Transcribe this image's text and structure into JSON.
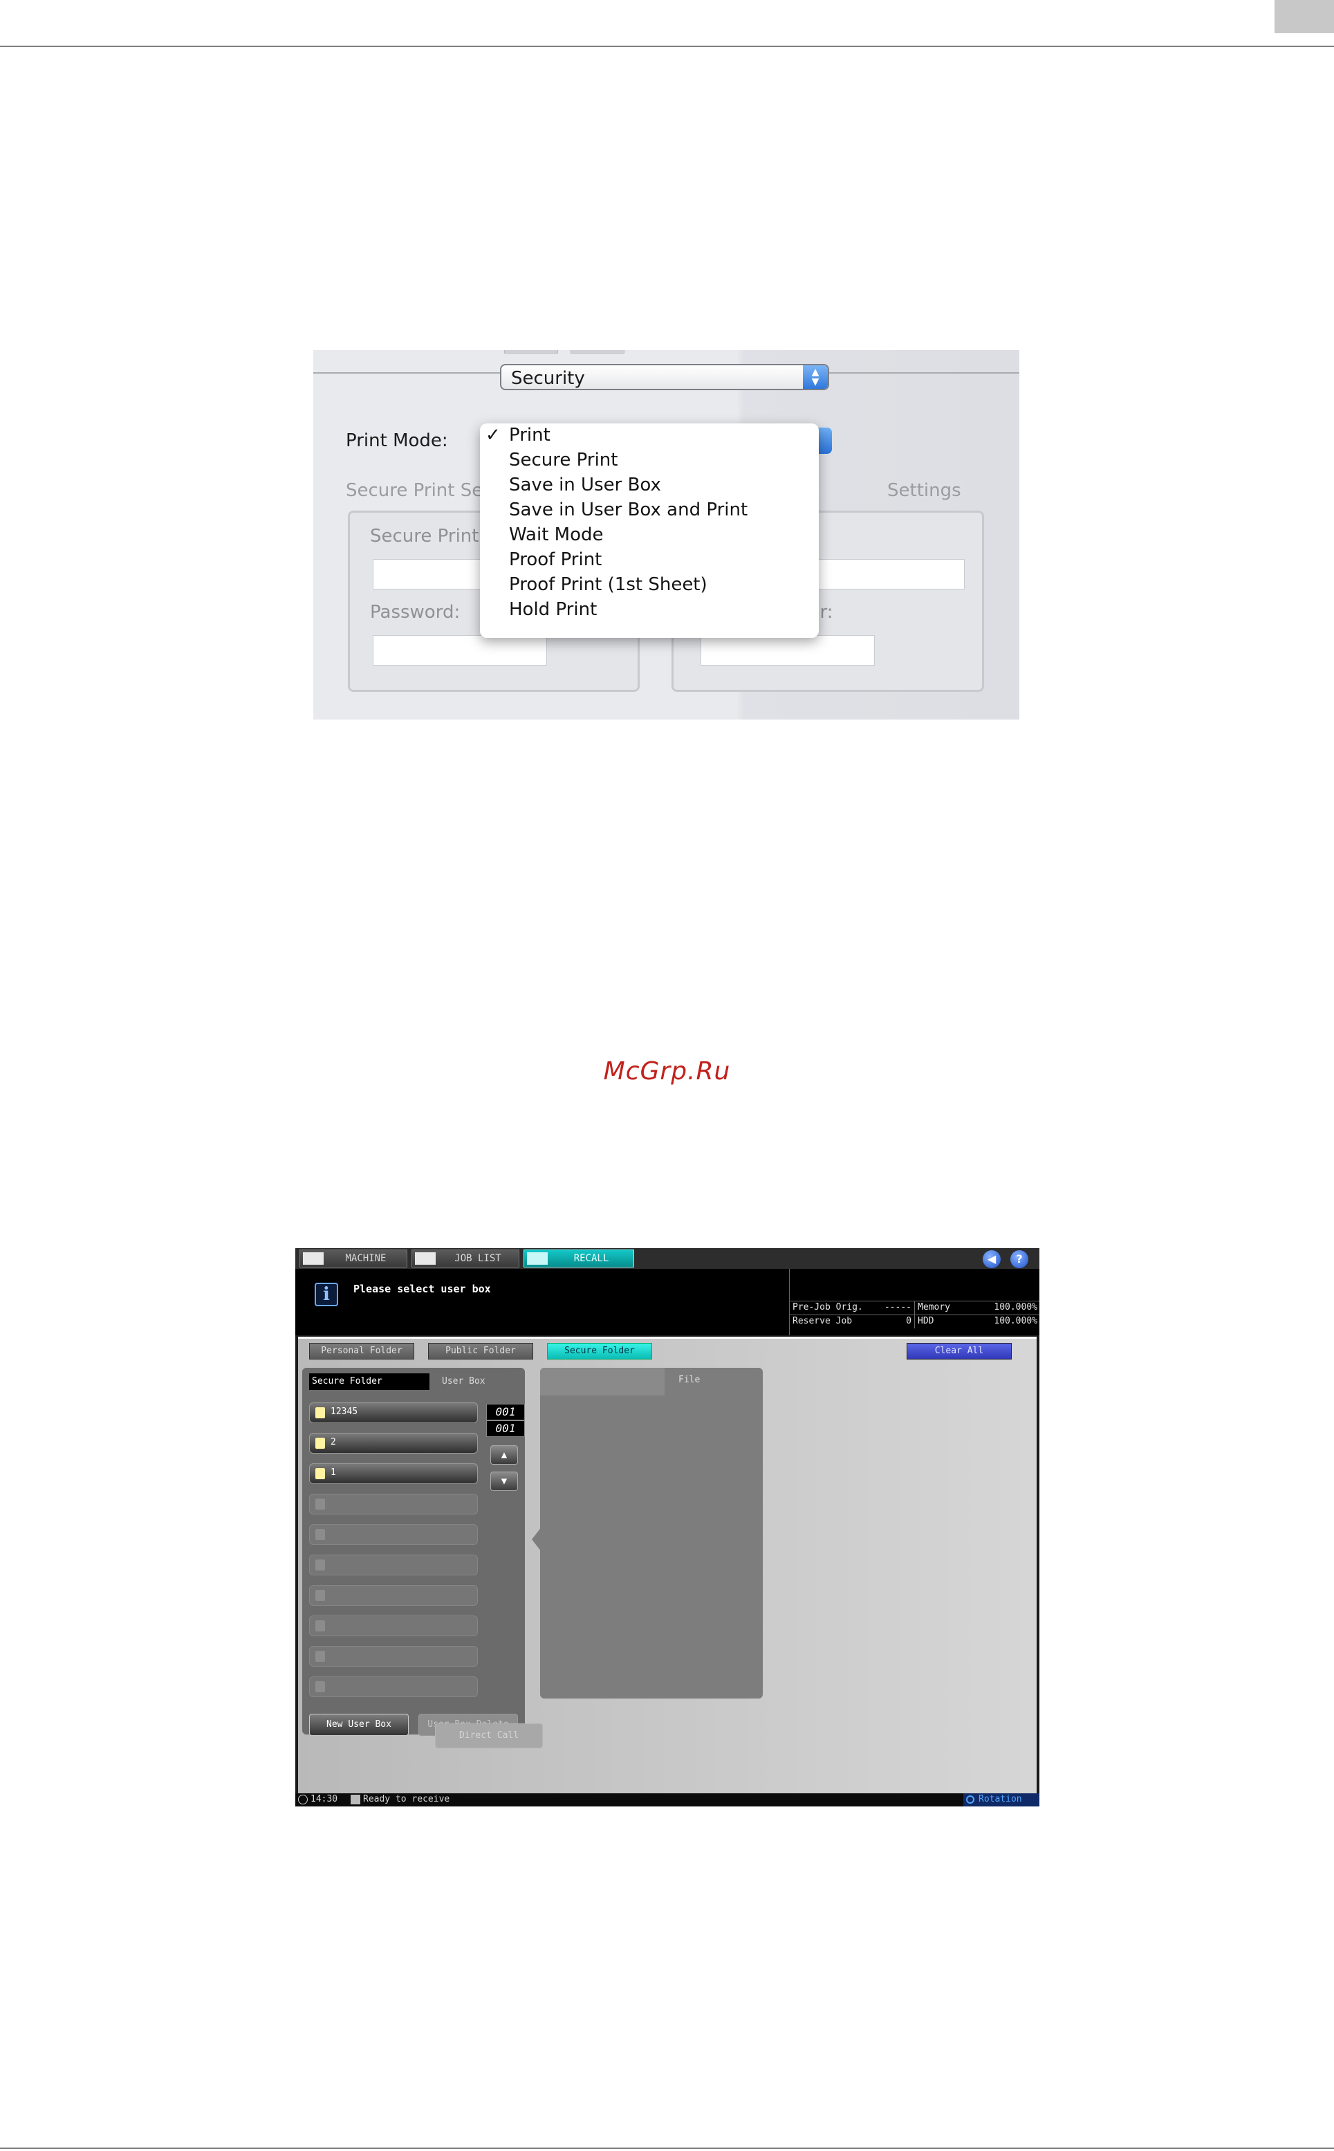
{
  "mac_dialog": {
    "section_popup": "Security",
    "print_mode_label": "Print Mode:",
    "secure_print_settings_label": "Secure Print Set",
    "save_in_box_settings_label": "Settings",
    "secure_print_id_label": "Secure Print",
    "password_label": "Password:",
    "right_field1_label": "",
    "right_field2_label": "ber:",
    "menu": {
      "check": "✓",
      "items": [
        "Print",
        "Secure Print",
        "Save in User Box",
        "Save in User Box and Print",
        "Wait Mode",
        "Proof Print",
        "Proof Print (1st Sheet)",
        "Hold Print"
      ],
      "selected": "Print"
    }
  },
  "watermark": "McGrp.Ru",
  "device": {
    "tabs": [
      "MACHINE",
      "JOB LIST",
      "RECALL"
    ],
    "active_tab": "RECALL",
    "help_icons": [
      "sound-icon",
      "help-icon"
    ],
    "help_glyph": "?",
    "sound_glyph": "◀",
    "info_glyph": "i",
    "message": "Please select user box",
    "status": {
      "pre_job_label": "Pre-Job Orig.",
      "pre_job_value": "-----",
      "memory_label": "Memory",
      "memory_value": "100.000%",
      "reserve_label": "Reserve Job",
      "reserve_value": "0",
      "hdd_label": "HDD",
      "hdd_value": "100.000%"
    },
    "folder_tabs": [
      "Personal Folder",
      "Public Folder",
      "Secure Folder"
    ],
    "active_folder": "Secure Folder",
    "clear_all": "Clear All",
    "secure_folder_label": "Secure Folder",
    "user_box_label": "User Box",
    "user_boxes": [
      "12345",
      "2",
      "1"
    ],
    "empty_slots": 7,
    "counter_top": "001",
    "counter_bottom": "001",
    "up_arrow": "▲",
    "down_arrow": "▼",
    "new_user_box": "New User Box",
    "user_box_delete": "User Box Delete",
    "direct_call": "Direct Call",
    "file_label": "File",
    "footer": {
      "time": "14:30",
      "status": "Ready to receive",
      "rotation": "Rotation"
    }
  }
}
